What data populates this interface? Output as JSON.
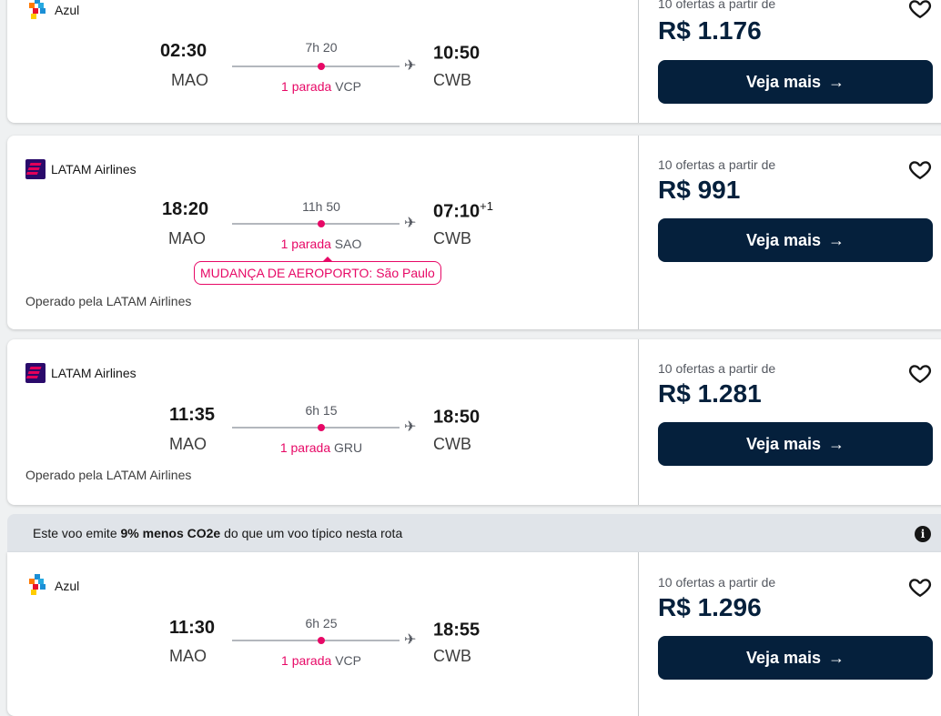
{
  "flights": [
    {
      "airline": "Azul",
      "dep_time": "02:30",
      "dep_code": "MAO",
      "duration": "7h 20",
      "stops_label": "1 parada",
      "stop_code": "VCP",
      "arr_time": "10:50",
      "arr_sup": "",
      "arr_code": "CWB",
      "offers": "10 ofertas a partir de",
      "price": "R$ 1.176",
      "cta": "Veja mais"
    },
    {
      "airline": "LATAM Airlines",
      "dep_time": "18:20",
      "dep_code": "MAO",
      "duration": "11h 50",
      "stops_label": "1 parada",
      "stop_code": "SAO",
      "arr_time": "07:10",
      "arr_sup": "+1",
      "arr_code": "CWB",
      "warning": "MUDANÇA DE AEROPORTO: São Paulo",
      "operated": "Operado pela LATAM Airlines",
      "offers": "10 ofertas a partir de",
      "price": "R$ 991",
      "cta": "Veja mais"
    },
    {
      "airline": "LATAM Airlines",
      "dep_time": "11:35",
      "dep_code": "MAO",
      "duration": "6h 15",
      "stops_label": "1 parada",
      "stop_code": "GRU",
      "arr_time": "18:50",
      "arr_sup": "",
      "arr_code": "CWB",
      "operated": "Operado pela LATAM Airlines",
      "offers": "10 ofertas a partir de",
      "price": "R$ 1.281",
      "cta": "Veja mais"
    },
    {
      "airline": "Azul",
      "dep_time": "11:30",
      "dep_code": "MAO",
      "duration": "6h 25",
      "stops_label": "1 parada",
      "stop_code": "VCP",
      "arr_time": "18:55",
      "arr_sup": "",
      "arr_code": "CWB",
      "offers": "10 ofertas a partir de",
      "price": "R$ 1.296",
      "cta": "Veja mais"
    }
  ],
  "eco_banner": {
    "pre": "Este voo emite ",
    "bold": "9% menos CO2e",
    "post": " do que um voo típico nesta rota"
  },
  "icons": {
    "heart": "heart-icon",
    "arrow": "arrow-right-icon",
    "plane": "plane-icon",
    "info": "info-icon"
  },
  "colors": {
    "accent": "#e70866",
    "button": "#05203c",
    "latam": "#2a0a6b"
  }
}
